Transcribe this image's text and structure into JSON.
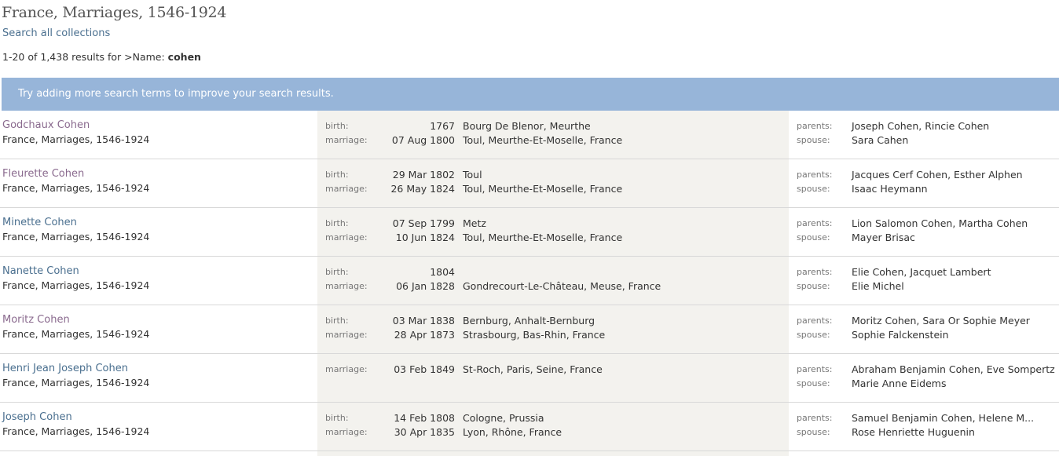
{
  "page": {
    "title": "France, Marriages, 1546-1924",
    "search_all_link": "Search all collections",
    "result_prefix": "1-20 of 1,438 results for >Name: ",
    "result_query": "cohen",
    "banner": "Try adding more search terms to improve your search results."
  },
  "colors": {
    "banner": "#97b5d9",
    "link": "#4a6f8f",
    "visited_link": "#8a6a8e",
    "events_background": "#f3f2ee"
  },
  "results": [
    {
      "name": "Godchaux Cohen",
      "visited": true,
      "collection": "France, Marriages, 1546-1924",
      "events": [
        {
          "label": "birth:",
          "date": "1767",
          "place": "Bourg De Blenor, Meurthe"
        },
        {
          "label": "marriage:",
          "date": "07 Aug 1800",
          "place": "Toul, Meurthe-Et-Moselle, France"
        }
      ],
      "relations": [
        {
          "label": "parents:",
          "value": "Joseph Cohen, Rincie Cohen"
        },
        {
          "label": "spouse:",
          "value": "Sara Cahen"
        }
      ]
    },
    {
      "name": "Fleurette Cohen",
      "visited": true,
      "collection": "France, Marriages, 1546-1924",
      "events": [
        {
          "label": "birth:",
          "date": "29 Mar 1802",
          "place": "Toul"
        },
        {
          "label": "marriage:",
          "date": "26 May 1824",
          "place": "Toul, Meurthe-Et-Moselle, France"
        }
      ],
      "relations": [
        {
          "label": "parents:",
          "value": "Jacques Cerf Cohen, Esther Alphen"
        },
        {
          "label": "spouse:",
          "value": "Isaac Heymann"
        }
      ]
    },
    {
      "name": "Minette Cohen",
      "visited": false,
      "collection": "France, Marriages, 1546-1924",
      "events": [
        {
          "label": "birth:",
          "date": "07 Sep 1799",
          "place": "Metz"
        },
        {
          "label": "marriage:",
          "date": "10 Jun 1824",
          "place": "Toul, Meurthe-Et-Moselle, France"
        }
      ],
      "relations": [
        {
          "label": "parents:",
          "value": "Lion Salomon Cohen, Martha Cohen"
        },
        {
          "label": "spouse:",
          "value": "Mayer Brisac"
        }
      ]
    },
    {
      "name": "Nanette Cohen",
      "visited": false,
      "collection": "France, Marriages, 1546-1924",
      "events": [
        {
          "label": "birth:",
          "date": "1804",
          "place": ""
        },
        {
          "label": "marriage:",
          "date": "06 Jan 1828",
          "place": "Gondrecourt-Le-Château, Meuse, France"
        }
      ],
      "relations": [
        {
          "label": "parents:",
          "value": "Elie Cohen, Jacquet Lambert"
        },
        {
          "label": "spouse:",
          "value": "Elie Michel"
        }
      ]
    },
    {
      "name": "Moritz Cohen",
      "visited": true,
      "collection": "France, Marriages, 1546-1924",
      "events": [
        {
          "label": "birth:",
          "date": "03 Mar 1838",
          "place": "Bernburg, Anhalt-Bernburg"
        },
        {
          "label": "marriage:",
          "date": "28 Apr 1873",
          "place": "Strasbourg, Bas-Rhin, France"
        }
      ],
      "relations": [
        {
          "label": "parents:",
          "value": "Moritz Cohen, Sara Or Sophie Meyer"
        },
        {
          "label": "spouse:",
          "value": "Sophie Falckenstein"
        }
      ]
    },
    {
      "name": "Henri Jean Joseph Cohen",
      "visited": false,
      "collection": "France, Marriages, 1546-1924",
      "events": [
        {
          "label": "marriage:",
          "date": "03 Feb 1849",
          "place": "St-Roch, Paris, Seine, France"
        }
      ],
      "relations": [
        {
          "label": "parents:",
          "value": "Abraham Benjamin Cohen, Eve Sompertz"
        },
        {
          "label": "spouse:",
          "value": "Marie Anne Eidems"
        }
      ]
    },
    {
      "name": "Joseph Cohen",
      "visited": false,
      "collection": "France, Marriages, 1546-1924",
      "events": [
        {
          "label": "birth:",
          "date": "14 Feb 1808",
          "place": "Cologne, Prussia"
        },
        {
          "label": "marriage:",
          "date": "30 Apr 1835",
          "place": "Lyon, Rhône, France"
        }
      ],
      "relations": [
        {
          "label": "parents:",
          "value": "Samuel Benjamin Cohen, Helene M..."
        },
        {
          "label": "spouse:",
          "value": "Rose Henriette Huguenin"
        }
      ]
    }
  ]
}
